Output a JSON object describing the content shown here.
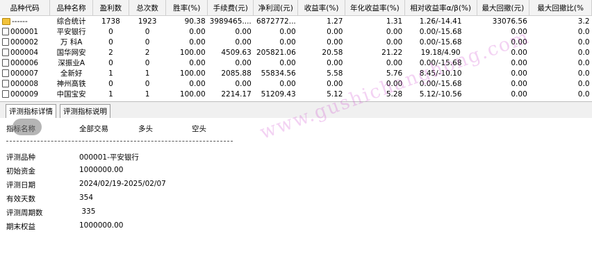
{
  "grid": {
    "columns": [
      "品种代码",
      "品种名称",
      "盈利数",
      "总次数",
      "胜率(%)",
      "手续费(元)",
      "净利润(元)",
      "收益率(%)",
      "年化收益率(%)",
      "相对收益率α/β(%)",
      "最大回撤(元)",
      "最大回撤比(%"
    ],
    "rows": [
      {
        "code": "------",
        "name": "综合统计",
        "profit": "1738",
        "total": "1923",
        "win": "90.38",
        "fee": "3989465....",
        "net": "6872772...",
        "ret": "1.27",
        "annual": "1.31",
        "rel": "1.26/-14.41",
        "dd": "33076.56",
        "ddr": "3.2",
        "icon": "summary-icon"
      },
      {
        "code": "000001",
        "name": "平安银行",
        "profit": "0",
        "total": "0",
        "win": "0.00",
        "fee": "0.00",
        "net": "0.00",
        "ret": "0.00",
        "annual": "0.00",
        "rel": "0.00/-15.68",
        "dd": "0.00",
        "ddr": "0.0",
        "icon": "document-icon"
      },
      {
        "code": "000002",
        "name": "万 科A",
        "profit": "0",
        "total": "0",
        "win": "0.00",
        "fee": "0.00",
        "net": "0.00",
        "ret": "0.00",
        "annual": "0.00",
        "rel": "0.00/-15.68",
        "dd": "0.00",
        "ddr": "0.0",
        "icon": "document-icon"
      },
      {
        "code": "000004",
        "name": "国华网安",
        "profit": "2",
        "total": "2",
        "win": "100.00",
        "fee": "4509.63",
        "net": "205821.06",
        "ret": "20.58",
        "annual": "21.22",
        "rel": "19.18/4.90",
        "dd": "0.00",
        "ddr": "0.0",
        "icon": "document-icon"
      },
      {
        "code": "000006",
        "name": "深振业A",
        "profit": "0",
        "total": "0",
        "win": "0.00",
        "fee": "0.00",
        "net": "0.00",
        "ret": "0.00",
        "annual": "0.00",
        "rel": "0.00/-15.68",
        "dd": "0.00",
        "ddr": "0.0",
        "icon": "document-icon"
      },
      {
        "code": "000007",
        "name": "全新好",
        "profit": "1",
        "total": "1",
        "win": "100.00",
        "fee": "2085.88",
        "net": "55834.56",
        "ret": "5.58",
        "annual": "5.76",
        "rel": "8.45/-10.10",
        "dd": "0.00",
        "ddr": "0.0",
        "icon": "document-icon"
      },
      {
        "code": "000008",
        "name": "神州高铁",
        "profit": "0",
        "total": "0",
        "win": "0.00",
        "fee": "0.00",
        "net": "0.00",
        "ret": "0.00",
        "annual": "0.00",
        "rel": "0.00/-15.68",
        "dd": "0.00",
        "ddr": "0.0",
        "icon": "document-icon"
      },
      {
        "code": "000009",
        "name": "中国宝安",
        "profit": "1",
        "total": "1",
        "win": "100.00",
        "fee": "2214.17",
        "net": "51209.43",
        "ret": "5.12",
        "annual": "5.28",
        "rel": "5.12/-10.56",
        "dd": "0.00",
        "ddr": "0.0",
        "icon": "document-icon"
      }
    ]
  },
  "tabs": [
    {
      "label": "评测指标详情"
    },
    {
      "label": "评测指标说明"
    }
  ],
  "detail": {
    "header": {
      "name": "指标名称",
      "all": "全部交易",
      "long": "多头",
      "short": "空头"
    },
    "items": [
      {
        "label": "评测品种",
        "value": "000001-平安银行"
      },
      {
        "label": "初始资金",
        "value": "1000000.00"
      },
      {
        "label": "评测日期",
        "value": "2024/02/19-2025/02/07"
      },
      {
        "label": "有效天数",
        "value": "354"
      },
      {
        "label": "评测周期数",
        "value": " 335"
      },
      {
        "label": "期末权益",
        "value": "1000000.00"
      }
    ]
  },
  "watermark": "www.gushichanghong.com",
  "colors": {
    "header_bg": "#f3f3f3",
    "watermark": "#cd3ccd"
  }
}
